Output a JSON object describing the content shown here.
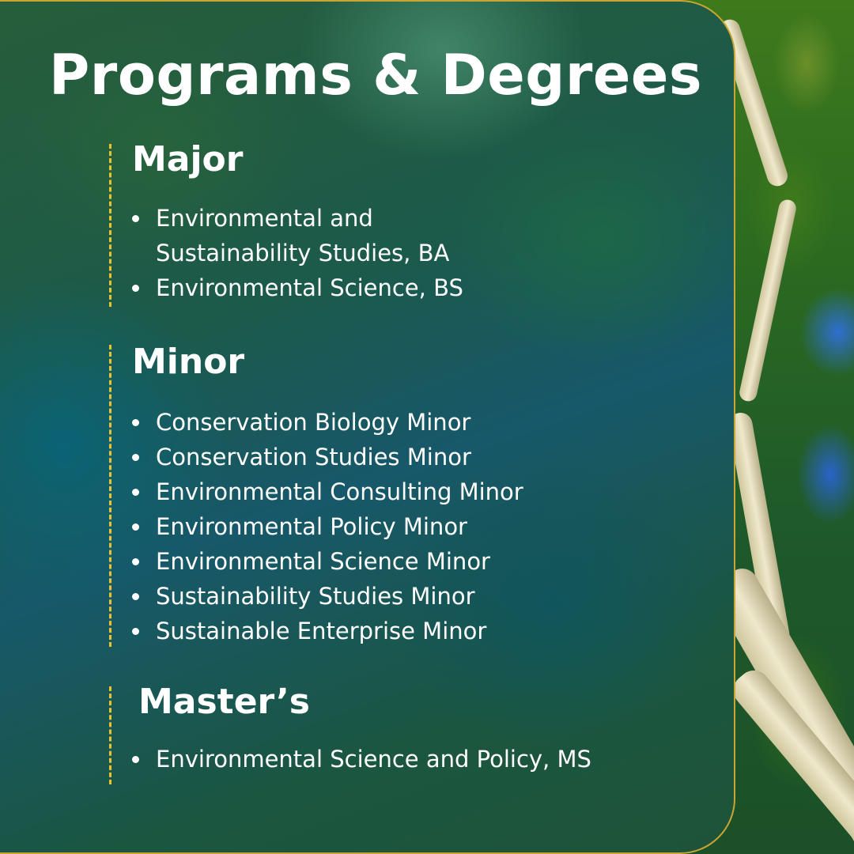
{
  "title": "Programs & Degrees",
  "sections": [
    {
      "heading": "Major",
      "items": [
        "Environmental and Sustainability Studies, BA",
        "Environmental Science, BS"
      ]
    },
    {
      "heading": "Minor",
      "items": [
        "Conservation Biology Minor",
        "Conservation Studies Minor",
        "Environmental Consulting Minor",
        "Environmental Policy Minor",
        "Environmental Science Minor",
        "Sustainability Studies Minor",
        "Sustainable Enterprise Minor"
      ]
    },
    {
      "heading": "Master’s",
      "items": [
        "Environmental Science and Policy, MS"
      ]
    }
  ],
  "colors": {
    "accent": "#e8c230",
    "panel_border": "#c9a634",
    "text": "#ffffff"
  }
}
